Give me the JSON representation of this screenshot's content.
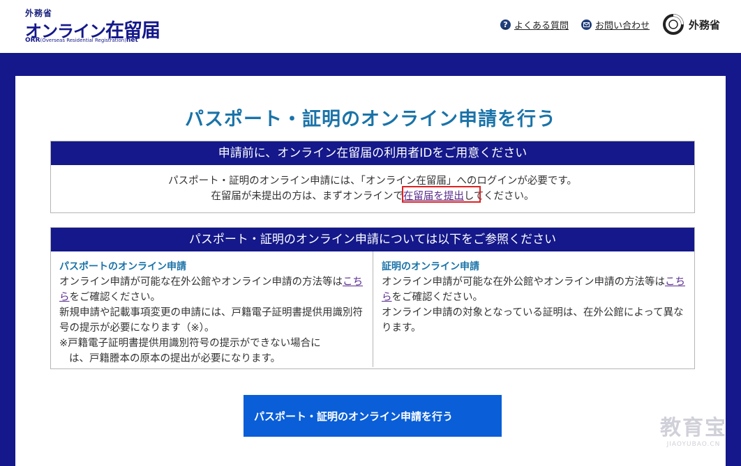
{
  "header": {
    "logo": {
      "ministry": "外務省",
      "title_prefix": "オンライン",
      "title_suffix": "在留届",
      "sub_abbr": "ORR",
      "sub_full": "(Overseas Residential Registration)",
      "sub_tld": "net"
    },
    "links": {
      "faq": "よくある質問",
      "contact": "お問い合わせ"
    },
    "brand": "外務省"
  },
  "main": {
    "title": "パスポート・証明のオンライン申請を行う",
    "notice": {
      "heading": "申請前に、オンライン在留届の利用者IDをご用意ください",
      "line1": "パスポート・証明のオンライン申請には、「オンライン在留届」へのログインが必要です。",
      "line2_before": "在留届が未提出の方は、まずオンラインで",
      "line2_link": "在留届を提出",
      "line2_after": "してください。"
    },
    "info": {
      "heading": "パスポート・証明のオンライン申請については以下をご参照ください",
      "passport": {
        "title": "パスポートのオンライン申請",
        "text1": "オンライン申請が可能な在外公館やオンライン申請の方法等は",
        "link": "こちら",
        "text2": "をご確認ください。",
        "text3": "新規申請や記載事項変更の申請には、戸籍電子証明書提供用識別符号の提示が必要になります（※）。",
        "note1": "※戸籍電子証明書提供用識別符号の提示ができない場合に",
        "note2": "は、戸籍謄本の原本の提出が必要になります。"
      },
      "certificate": {
        "title": "証明のオンライン申請",
        "text1": "オンライン申請が可能な在外公館やオンライン申請の方法等は",
        "link": "こちら",
        "text2": "をご確認ください。",
        "text3": "オンライン申請の対象となっている証明は、在外公館によって異なります。"
      }
    },
    "cta_label": "パスポート・証明のオンライン申請を行う"
  },
  "watermark": {
    "main": "教育宝",
    "sub": "JIAOYUBAO.CN"
  },
  "colors": {
    "navy": "#14188a",
    "title_blue": "#1a73a8",
    "cta_blue": "#0a5ed7",
    "highlight_red": "#e02020",
    "link_purple": "#5b2d8e"
  },
  "icons": [
    "question-circle-icon",
    "mail-icon",
    "ministry-logo-icon"
  ]
}
